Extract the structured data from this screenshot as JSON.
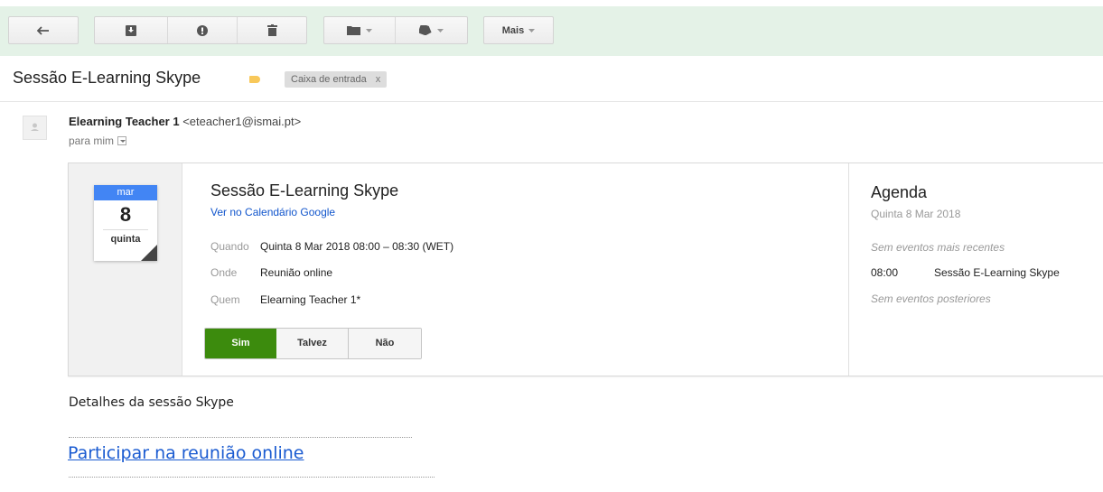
{
  "toolbar": {
    "more_label": "Mais"
  },
  "message": {
    "subject": "Sessão E-Learning Skype",
    "inbox_label": "Caixa de entrada",
    "inbox_remove": "x",
    "sender_name": "Elearning Teacher 1",
    "sender_email": "<eteacher1@ismai.pt>",
    "recipient": "para mim"
  },
  "invite": {
    "cal_month": "mar",
    "cal_day": "8",
    "cal_weekday": "quinta",
    "title": "Sessão E-Learning Skype",
    "calendar_link": "Ver no Calendário Google",
    "when_label": "Quando",
    "when_value": "Quinta 8 Mar 2018 08:00 – 08:30 (WET)",
    "where_label": "Onde",
    "where_value": "Reunião online",
    "who_label": "Quem",
    "who_value": "Elearning Teacher 1*",
    "rsvp_yes": "Sim",
    "rsvp_maybe": "Talvez",
    "rsvp_no": "Não"
  },
  "agenda": {
    "title": "Agenda",
    "date": "Quinta 8 Mar 2018",
    "no_earlier": "Sem eventos mais recentes",
    "event_time": "08:00",
    "event_name": "Sessão E-Learning Skype",
    "no_later": "Sem eventos posteriores"
  },
  "body": {
    "details": "Detalhes da sessão Skype",
    "join_link": "Participar na reunião online"
  },
  "colors": {
    "toolbar_bg": "#e4f2e7",
    "accent_blue": "#4285f4",
    "link": "#1155cc",
    "yes_green": "#3c8b0d"
  }
}
